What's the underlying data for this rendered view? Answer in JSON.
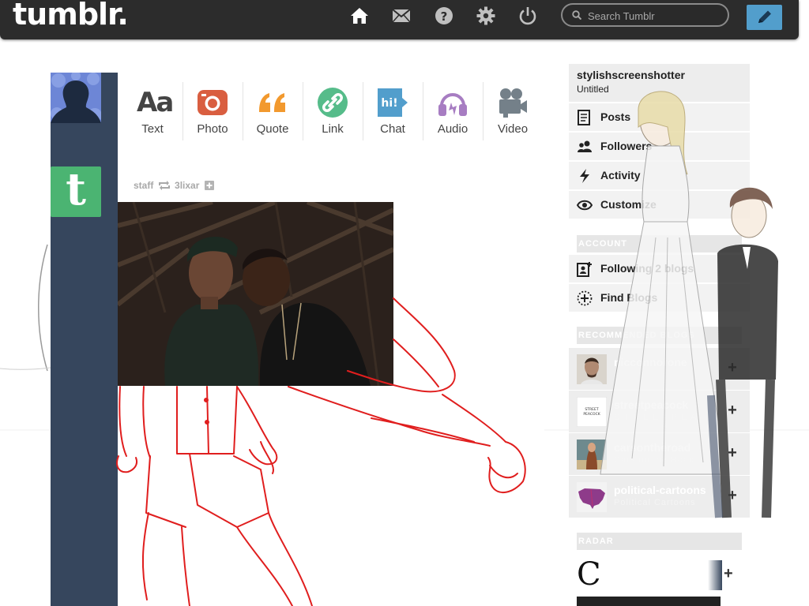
{
  "brand": {
    "logo": "tumblr.",
    "accent": "#529ecc",
    "rail_color": "#36465d"
  },
  "topbar": {
    "nav_icons": [
      "home-icon",
      "mail-icon",
      "help-icon",
      "gear-icon",
      "power-icon"
    ],
    "search": {
      "placeholder": "Search Tumblr",
      "value": ""
    },
    "compose_icon": "pencil-icon"
  },
  "post_types": [
    {
      "label": "Text",
      "glyph": "Aa",
      "color": "#444444"
    },
    {
      "label": "Photo",
      "icon": "camera-icon",
      "color": "#d95e40"
    },
    {
      "label": "Quote",
      "glyph": "❝❞",
      "color": "#f2992e"
    },
    {
      "label": "Link",
      "icon": "link-icon",
      "color": "#56bc8a"
    },
    {
      "label": "Chat",
      "glyph": "hi!",
      "color": "#529ecc"
    },
    {
      "label": "Audio",
      "icon": "headphones-icon",
      "color": "#a77dc2"
    },
    {
      "label": "Video",
      "icon": "video-camera-icon",
      "color": "#748089"
    }
  ],
  "post": {
    "author": "staff",
    "reblog_icon": "reblog-icon",
    "reblogged_from": "3lixar",
    "follow_icon": "plus-icon"
  },
  "sidebar": {
    "blog_name": "stylishscreenshotter",
    "blog_title": "Untitled",
    "blog_menu": [
      {
        "label": "Posts",
        "icon": "posts-icon"
      },
      {
        "label": "Followers",
        "icon": "followers-icon"
      },
      {
        "label": "Activity",
        "icon": "lightning-icon"
      },
      {
        "label": "Customize",
        "icon": "eye-icon"
      }
    ],
    "account_heading": "ACCOUNT",
    "account_menu": [
      {
        "label": "Following 2 blogs",
        "icon": "following-icon"
      },
      {
        "label": "Find Blogs",
        "icon": "compass-icon"
      }
    ],
    "recommended_heading": "RECOMMENDED BLOGS",
    "recommended": [
      {
        "name": "nicconnorone",
        "title": ""
      },
      {
        "name": "streetpeacock",
        "title": "S T R E E T P E A"
      },
      {
        "name": "carsontheroad",
        "title": "Cars on the Road"
      },
      {
        "name": "political-cartoons",
        "title": "Political Cartoons"
      }
    ],
    "recommended_add": "+",
    "radar_heading": "RADAR",
    "radar_add": "+"
  }
}
